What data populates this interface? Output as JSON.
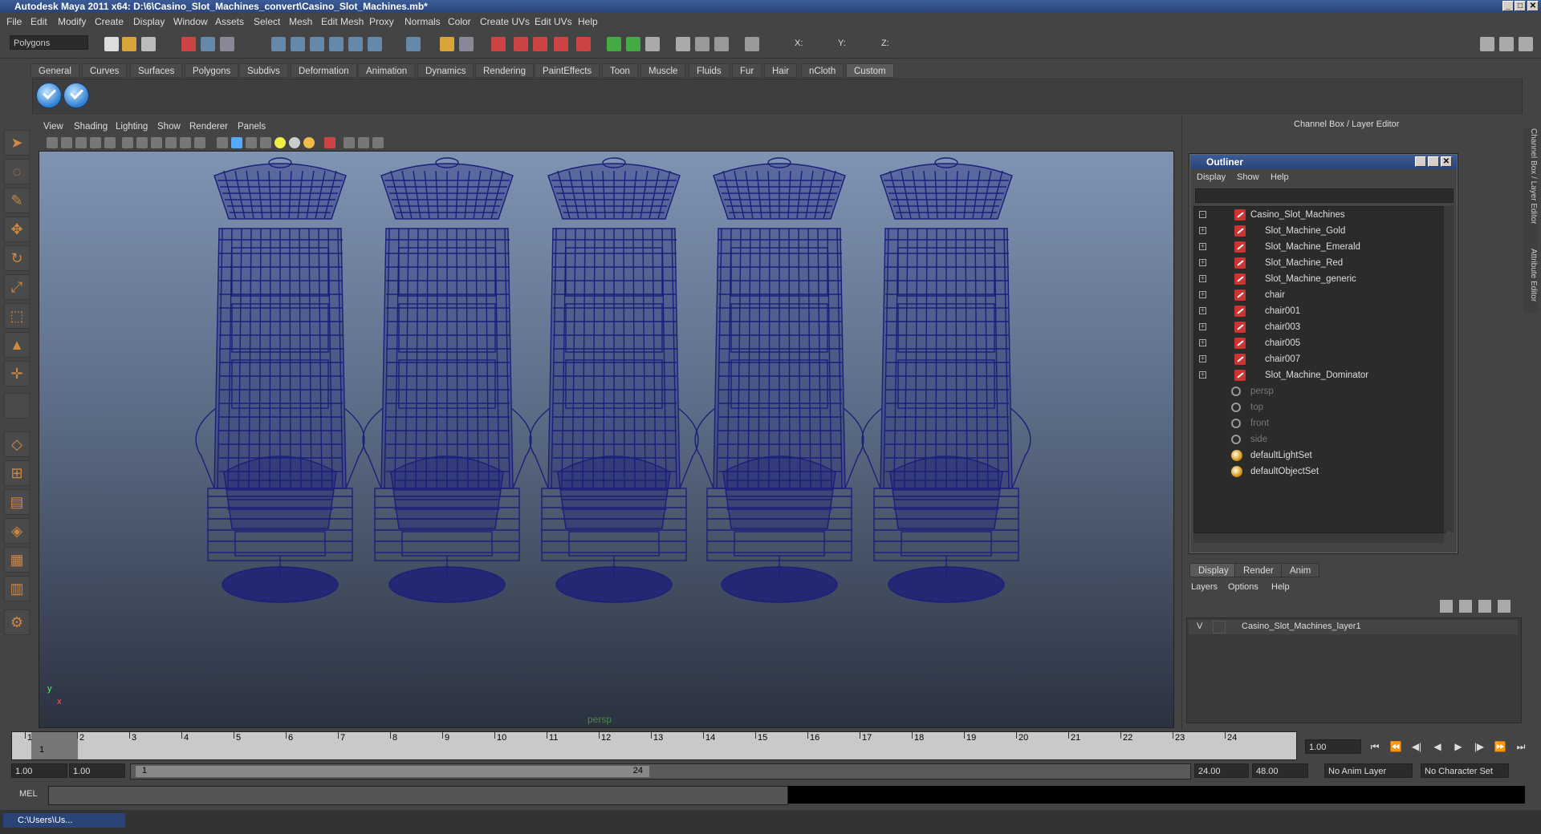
{
  "window": {
    "title": "Autodesk Maya 2011 x64: D:\\6\\Casino_Slot_Machines_convert\\Casino_Slot_Machines.mb*",
    "controls": [
      "_",
      "□",
      "✕"
    ]
  },
  "menubar": [
    "File",
    "Edit",
    "Modify",
    "Create",
    "Display",
    "Window",
    "Assets",
    "Select",
    "Mesh",
    "Edit Mesh",
    "Proxy",
    "Normals",
    "Color",
    "Create UVs",
    "Edit UVs",
    "Help"
  ],
  "statusline": {
    "mode": "Polygons",
    "x_label": "X:",
    "y_label": "Y:",
    "z_label": "Z:"
  },
  "shelf": {
    "tabs": [
      "General",
      "Curves",
      "Surfaces",
      "Polygons",
      "Subdivs",
      "Deformation",
      "Animation",
      "Dynamics",
      "Rendering",
      "PaintEffects",
      "Toon",
      "Muscle",
      "Fluids",
      "Fur",
      "Hair",
      "nCloth",
      "Custom"
    ],
    "active_tab": "Custom"
  },
  "viewport": {
    "menu": [
      "View",
      "Shading",
      "Lighting",
      "Show",
      "Renderer",
      "Panels"
    ],
    "camera_label": "persp",
    "axis_y": "y",
    "axis_x": "x",
    "background_top": "#7f93b3",
    "wire_color": "#1b1f7a"
  },
  "channel_box": {
    "header": "Channel Box / Layer Editor",
    "side_tabs": [
      "Channel Box / Layer Editor",
      "Attribute Editor"
    ]
  },
  "outliner": {
    "title": "Outliner",
    "menu": [
      "Display",
      "Show",
      "Help"
    ],
    "items": [
      {
        "name": "Casino_Slot_Machines",
        "kind": "mesh",
        "expander": "-",
        "indent": 0,
        "dim": false
      },
      {
        "name": "Slot_Machine_Gold",
        "kind": "mesh",
        "expander": "+",
        "indent": 1,
        "dim": false
      },
      {
        "name": "Slot_Machine_Emerald",
        "kind": "mesh",
        "expander": "+",
        "indent": 1,
        "dim": false
      },
      {
        "name": "Slot_Machine_Red",
        "kind": "mesh",
        "expander": "+",
        "indent": 1,
        "dim": false
      },
      {
        "name": "Slot_Machine_generic",
        "kind": "mesh",
        "expander": "+",
        "indent": 1,
        "dim": false
      },
      {
        "name": "chair",
        "kind": "mesh",
        "expander": "+",
        "indent": 1,
        "dim": false
      },
      {
        "name": "chair001",
        "kind": "mesh",
        "expander": "+",
        "indent": 1,
        "dim": false
      },
      {
        "name": "chair003",
        "kind": "mesh",
        "expander": "+",
        "indent": 1,
        "dim": false
      },
      {
        "name": "chair005",
        "kind": "mesh",
        "expander": "+",
        "indent": 1,
        "dim": false
      },
      {
        "name": "chair007",
        "kind": "mesh",
        "expander": "+",
        "indent": 1,
        "dim": false
      },
      {
        "name": "Slot_Machine_Dominator",
        "kind": "mesh",
        "expander": "+",
        "indent": 1,
        "dim": false
      },
      {
        "name": "persp",
        "kind": "camera",
        "expander": "",
        "indent": 0,
        "dim": true
      },
      {
        "name": "top",
        "kind": "camera",
        "expander": "",
        "indent": 0,
        "dim": true
      },
      {
        "name": "front",
        "kind": "camera",
        "expander": "",
        "indent": 0,
        "dim": true
      },
      {
        "name": "side",
        "kind": "camera",
        "expander": "",
        "indent": 0,
        "dim": true
      },
      {
        "name": "defaultLightSet",
        "kind": "set",
        "expander": "",
        "indent": 0,
        "dim": false
      },
      {
        "name": "defaultObjectSet",
        "kind": "set",
        "expander": "",
        "indent": 0,
        "dim": false
      }
    ]
  },
  "layer_editor": {
    "tabs": [
      "Display",
      "Render",
      "Anim"
    ],
    "active_tab": "Display",
    "menu": [
      "Layers",
      "Options",
      "Help"
    ],
    "layers": [
      {
        "visible": "V",
        "name": "Casino_Slot_Machines_layer1"
      }
    ]
  },
  "timeline": {
    "ticks": [
      "1",
      "2",
      "3",
      "4",
      "5",
      "6",
      "7",
      "8",
      "9",
      "10",
      "11",
      "12",
      "13",
      "14",
      "15",
      "16",
      "17",
      "18",
      "19",
      "20",
      "21",
      "22",
      "23",
      "24"
    ],
    "current_frame": "1.00",
    "cursor_frame": "1"
  },
  "range": {
    "start": "1.00",
    "playback_start": "1.00",
    "handle_start": "1",
    "handle_end": "24",
    "playback_end": "24.00",
    "end": "48.00",
    "anim_layer": "No Anim Layer",
    "character_set": "No Character Set"
  },
  "commandline": {
    "label": "MEL"
  },
  "taskbar": {
    "item": "C:\\Users\\Us..."
  }
}
